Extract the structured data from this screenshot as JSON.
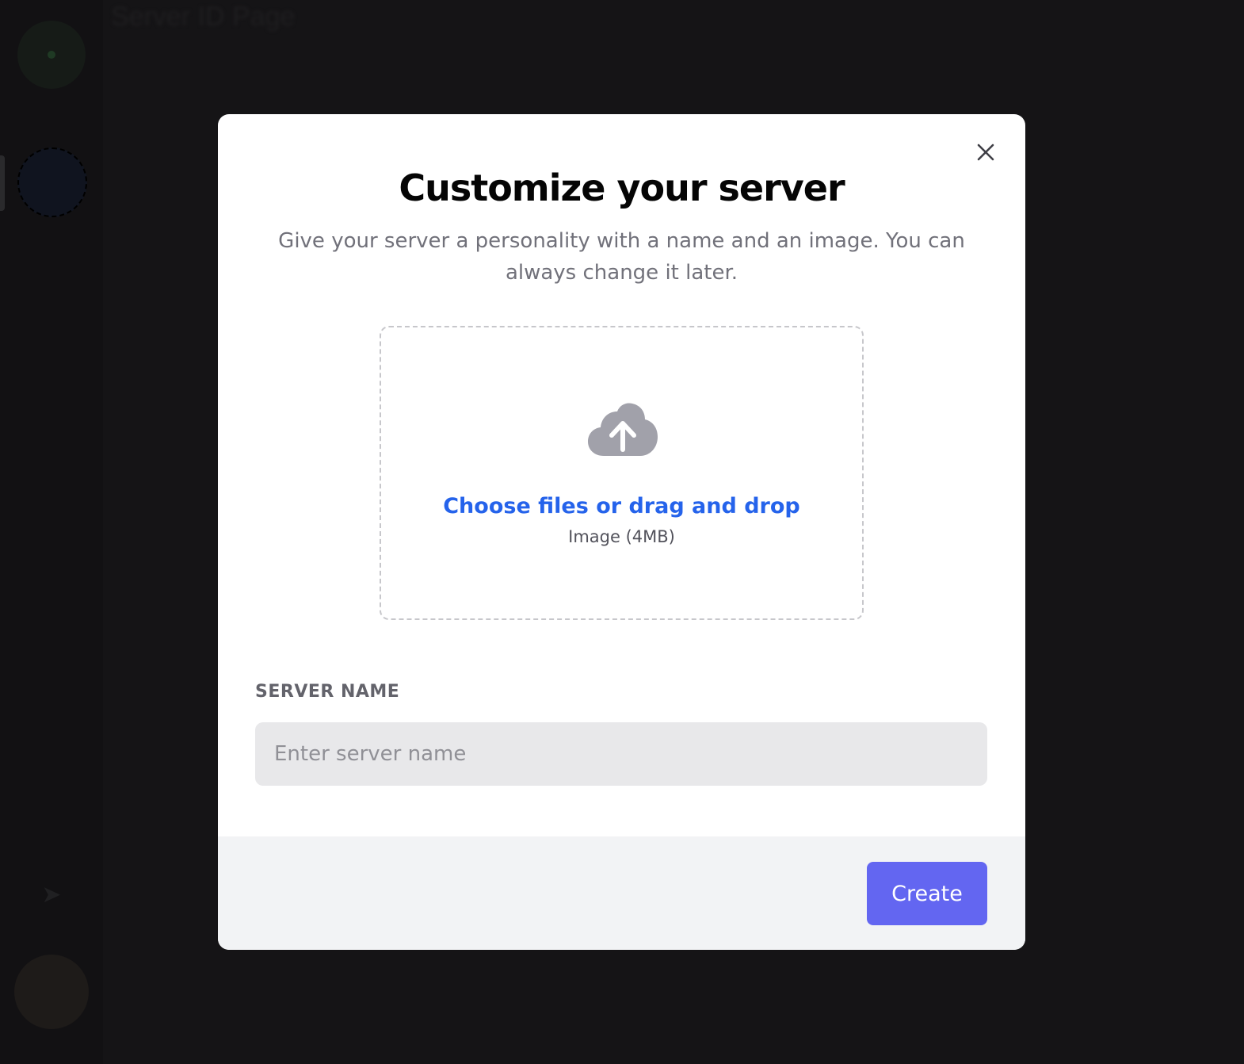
{
  "background": {
    "page_title": "Server ID Page",
    "explore_icon": "compass-icon"
  },
  "modal": {
    "title": "Customize your server",
    "subtitle": "Give your server a personality with a name and an image. You can always change it later.",
    "close_icon": "close-icon",
    "upload": {
      "icon": "cloud-upload-icon",
      "label": "Choose files or drag and drop",
      "hint": "Image (4MB)"
    },
    "server_name": {
      "label": "SERVER NAME",
      "placeholder": "Enter server name",
      "value": ""
    },
    "create_label": "Create"
  },
  "colors": {
    "overlay": "#151416",
    "accent": "#6366f1",
    "link": "#2563eb",
    "footer": "#f2f3f5",
    "input_bg": "#e8e8ea"
  }
}
